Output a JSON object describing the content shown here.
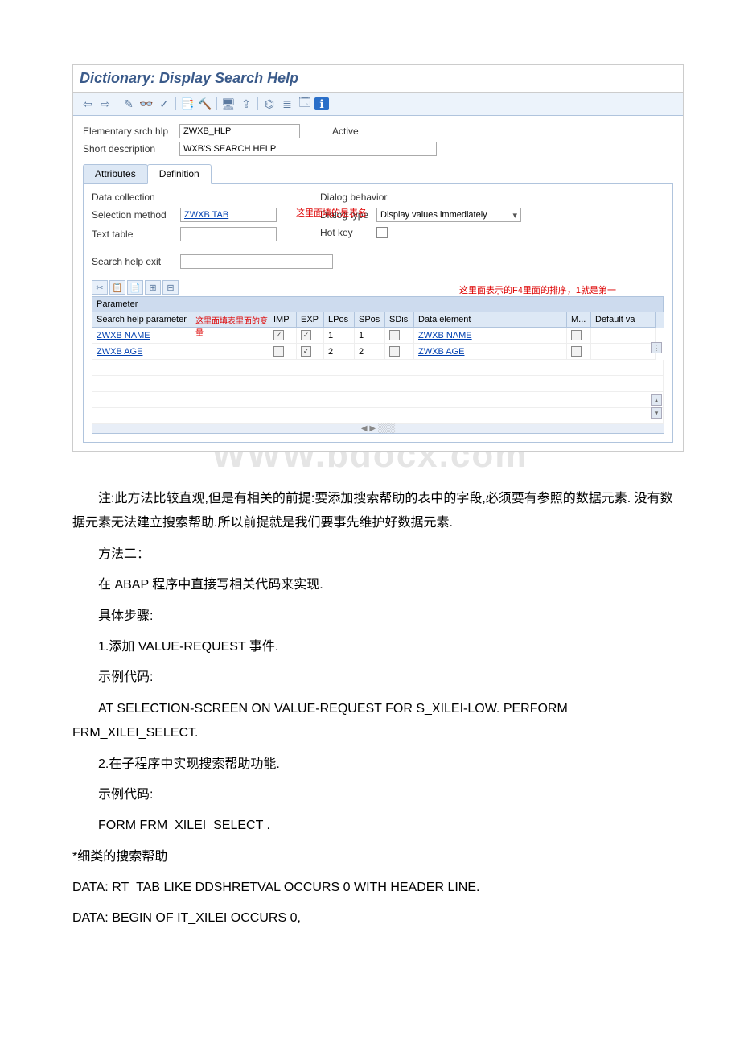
{
  "title": "Dictionary: Display Search Help",
  "form": {
    "srch_hlp_label": "Elementary srch hlp",
    "srch_hlp_value": "ZWXB_HLP",
    "status": "Active",
    "short_desc_label": "Short description",
    "short_desc_value": "WXB'S SEARCH HELP"
  },
  "tabs": {
    "attributes": "Attributes",
    "definition": "Definition"
  },
  "data_coll": {
    "section": "Data collection",
    "sel_method_label": "Selection method",
    "sel_method_value": "ZWXB TAB",
    "text_table_label": "Text table",
    "search_exit_label": "Search help exit"
  },
  "dialog": {
    "section": "Dialog behavior",
    "type_label": "Dialog type",
    "type_value": "Display values immediately",
    "hotkey_label": "Hot key"
  },
  "ann": {
    "table_name": "这里面填的是表名",
    "param_var": "这里面填表里面的变量",
    "sort_note": "这里面表示的F4里面的排序，1就是第一"
  },
  "grid": {
    "param_label": "Parameter",
    "headers": {
      "c1": "Search help parameter",
      "c2": "IMP",
      "c3": "EXP",
      "c4": "LPos",
      "c5": "SPos",
      "c6": "SDis",
      "c7": "Data element",
      "c8": "M...",
      "c9": "Default va"
    },
    "rows": [
      {
        "param": "ZWXB NAME",
        "imp": true,
        "exp": true,
        "lpos": "1",
        "spos": "1",
        "sdis": false,
        "de": "ZWXB NAME",
        "m": false
      },
      {
        "param": "ZWXB AGE",
        "imp": false,
        "exp": true,
        "lpos": "2",
        "spos": "2",
        "sdis": false,
        "de": "ZWXB AGE",
        "m": false
      }
    ]
  },
  "watermark": "WWW.bdocx.com",
  "article": {
    "p1": "注:此方法比较直观,但是有相关的前提:要添加搜索帮助的表中的字段,必须要有参照的数据元素. 没有数据元素无法建立搜索帮助.所以前提就是我们要事先维护好数据元素.",
    "p2": "方法二：",
    "p3": "在 ABAP 程序中直接写相关代码来实现.",
    "p4": "具体步骤:",
    "p5": "1.添加 VALUE-REQUEST 事件.",
    "p6": "示例代码:",
    "p7": "AT SELECTION-SCREEN ON VALUE-REQUEST FOR S_XILEI-LOW. PERFORM FRM_XILEI_SELECT.",
    "p8": "2.在子程序中实现搜索帮助功能.",
    "p9": "示例代码:",
    "p10": "FORM FRM_XILEI_SELECT .",
    "p11": "*细类的搜索帮助",
    "p12": "DATA: RT_TAB LIKE DDSHRETVAL OCCURS 0 WITH HEADER LINE.",
    "p13": "DATA: BEGIN OF IT_XILEI OCCURS 0,"
  }
}
